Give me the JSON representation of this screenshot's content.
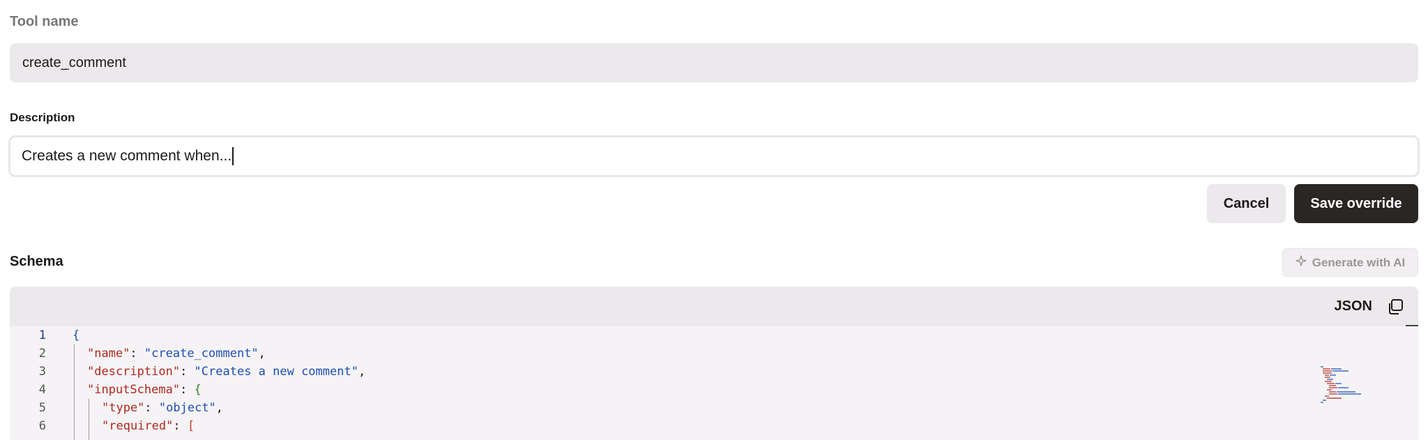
{
  "tool_name": {
    "label": "Tool name",
    "value": "create_comment"
  },
  "description": {
    "label": "Description",
    "value": "Creates a new comment when..."
  },
  "actions": {
    "cancel_label": "Cancel",
    "save_label": "Save override"
  },
  "schema": {
    "title": "Schema",
    "generate_label": "Generate with AI",
    "language": "JSON",
    "line_numbers": [
      "1",
      "2",
      "3",
      "4",
      "5",
      "6"
    ],
    "lines": [
      {
        "key": "",
        "value": "{"
      },
      {
        "key": "\"name\"",
        "value": "\"create_comment\""
      },
      {
        "key": "\"description\"",
        "value": "\"Creates a new comment\""
      },
      {
        "key": "\"inputSchema\"",
        "value": "{"
      },
      {
        "key": "\"type\"",
        "value": "\"object\""
      },
      {
        "key": "\"required\"",
        "value": "["
      }
    ]
  },
  "icons": {
    "sparkle": "sparkle-icon",
    "copy": "copy-icon"
  },
  "colors": {
    "primary_button": "#2a2624",
    "field_bg": "#ebe9eb",
    "code_key": "#b0281f",
    "code_string": "#1d4fb0"
  }
}
